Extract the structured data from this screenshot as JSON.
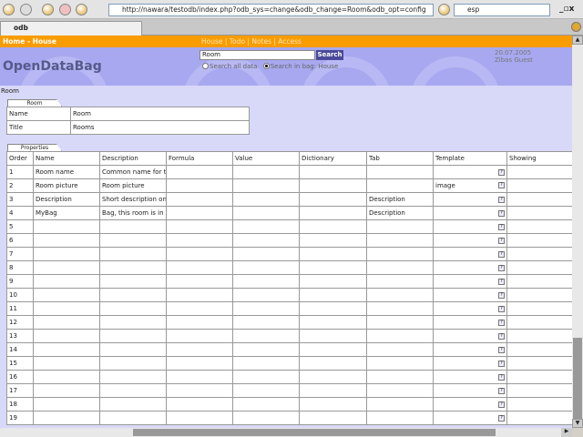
{
  "browser": {
    "url": "http://nawara/testodb/index.php?odb_sys=change&odb_change=Room&odb_opt=config",
    "search": "esp",
    "tab": "odb"
  },
  "nav": {
    "crumb": "Home - House",
    "links": "House | Todo | Notes | Access"
  },
  "header": {
    "logo": "OpenDataBag",
    "search_value": "Room",
    "search_button": "Search",
    "radio_all": "Search all data",
    "radio_bag": "Search in bag: House",
    "date": "20.07.2005",
    "user": "Zibas Guest"
  },
  "page_label": "Room",
  "room": {
    "legend": "Room",
    "rows": [
      {
        "label": "Name",
        "value": "Room"
      },
      {
        "label": "Title",
        "value": "Rooms"
      }
    ]
  },
  "properties": {
    "legend": "Properties",
    "columns": [
      "Order",
      "Name",
      "Description",
      "Formula",
      "Value",
      "Dictionary",
      "Tab",
      "Template",
      "Showing"
    ],
    "rows": [
      [
        "1",
        "Room name",
        "Common name for the",
        "",
        "",
        "",
        "",
        "",
        ""
      ],
      [
        "2",
        "Room picture",
        "Room picture",
        "",
        "",
        "",
        "",
        "image",
        ""
      ],
      [
        "3",
        "Description",
        "Short description on t",
        "",
        "",
        "",
        "Description",
        "",
        ""
      ],
      [
        "4",
        "MyBag",
        "Bag, this room is in - s",
        "",
        "",
        "",
        "Description",
        "",
        ""
      ],
      [
        "5",
        "",
        "",
        "",
        "",
        "",
        "",
        "",
        ""
      ],
      [
        "6",
        "",
        "",
        "",
        "",
        "",
        "",
        "",
        ""
      ],
      [
        "7",
        "",
        "",
        "",
        "",
        "",
        "",
        "",
        ""
      ],
      [
        "8",
        "",
        "",
        "",
        "",
        "",
        "",
        "",
        ""
      ],
      [
        "9",
        "",
        "",
        "",
        "",
        "",
        "",
        "",
        ""
      ],
      [
        "10",
        "",
        "",
        "",
        "",
        "",
        "",
        "",
        ""
      ],
      [
        "11",
        "",
        "",
        "",
        "",
        "",
        "",
        "",
        ""
      ],
      [
        "12",
        "",
        "",
        "",
        "",
        "",
        "",
        "",
        ""
      ],
      [
        "13",
        "",
        "",
        "",
        "",
        "",
        "",
        "",
        ""
      ],
      [
        "14",
        "",
        "",
        "",
        "",
        "",
        "",
        "",
        ""
      ],
      [
        "15",
        "",
        "",
        "",
        "",
        "",
        "",
        "",
        ""
      ],
      [
        "16",
        "",
        "",
        "",
        "",
        "",
        "",
        "",
        ""
      ],
      [
        "17",
        "",
        "",
        "",
        "",
        "",
        "",
        "",
        ""
      ],
      [
        "18",
        "",
        "",
        "",
        "",
        "",
        "",
        "",
        ""
      ],
      [
        "19",
        "",
        "",
        "",
        "",
        "",
        "",
        "",
        ""
      ]
    ]
  }
}
